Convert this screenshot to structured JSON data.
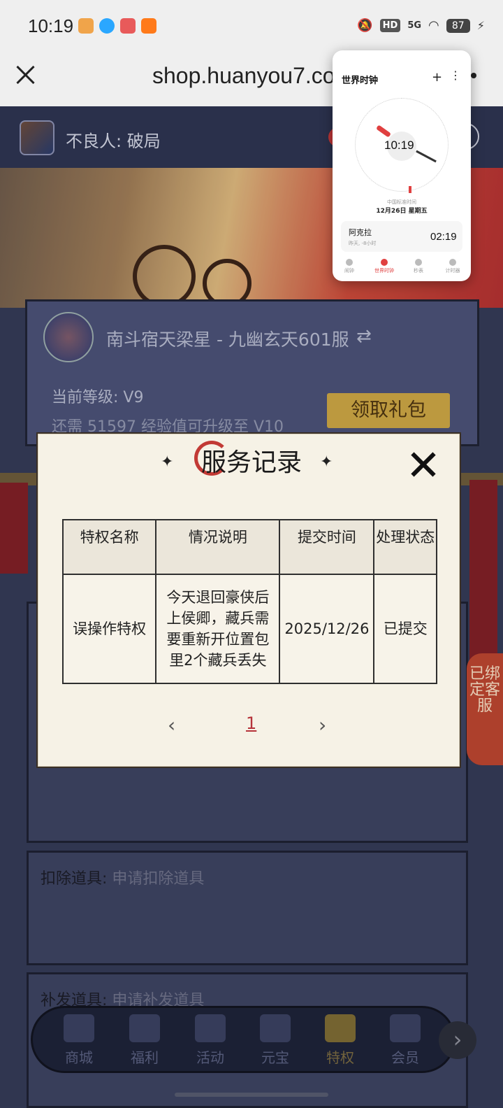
{
  "status_bar": {
    "time": "10:19",
    "network": "5G",
    "hd": "HD",
    "battery": "87"
  },
  "browser": {
    "url": "shop.huanyou7.com"
  },
  "header": {
    "game_name": "不良人: 破局"
  },
  "user_card": {
    "server": "南斗宿天梁星 - 九幽玄天601服",
    "swap_icon": "⇄",
    "level": "当前等级: V9",
    "exp_needed": "还需 51597 经验值可升级至 V10",
    "claim_button": "领取礼包"
  },
  "sections": [
    {
      "label": "扣除道具:",
      "link": "申请扣除道具"
    },
    {
      "label": "补发道具:",
      "link": "申请补发道具"
    }
  ],
  "bound_service": "已绑定客服",
  "bottom_nav": [
    {
      "label": "商城",
      "icon": "shop-icon"
    },
    {
      "label": "福利",
      "icon": "gift-icon"
    },
    {
      "label": "活动",
      "icon": "activity-icon"
    },
    {
      "label": "元宝",
      "icon": "ingot-icon"
    },
    {
      "label": "特权",
      "icon": "privilege-icon",
      "active": true
    },
    {
      "label": "会员",
      "icon": "member-icon"
    }
  ],
  "modal": {
    "title": "服务记录",
    "columns": [
      "特权名称",
      "情况说明",
      "提交时间",
      "处理状态"
    ],
    "rows": [
      {
        "privilege": "误操作特权",
        "description": "今天退回豪侠后上侯卿，藏兵需要重新开位置包里2个藏兵丢失",
        "submitted": "2025/12/26",
        "status": "已提交"
      }
    ],
    "pagination": {
      "prev": "‹",
      "current": "1",
      "next": "›"
    }
  },
  "world_clock": {
    "title": "世界时钟",
    "time": "10:19",
    "zone": "中国标准时间",
    "date": "12月26日 星期五",
    "city": {
      "name": "阿克拉",
      "diff": "昨天, -8小时",
      "time": "02:19"
    },
    "tabs": [
      "闹钟",
      "世界时钟",
      "秒表",
      "计时器"
    ],
    "active_tab": "世界时钟"
  },
  "colors": {
    "accent_red": "#c23a35",
    "gold_button": "#c8a343",
    "modal_bg": "#f6f2e6"
  }
}
